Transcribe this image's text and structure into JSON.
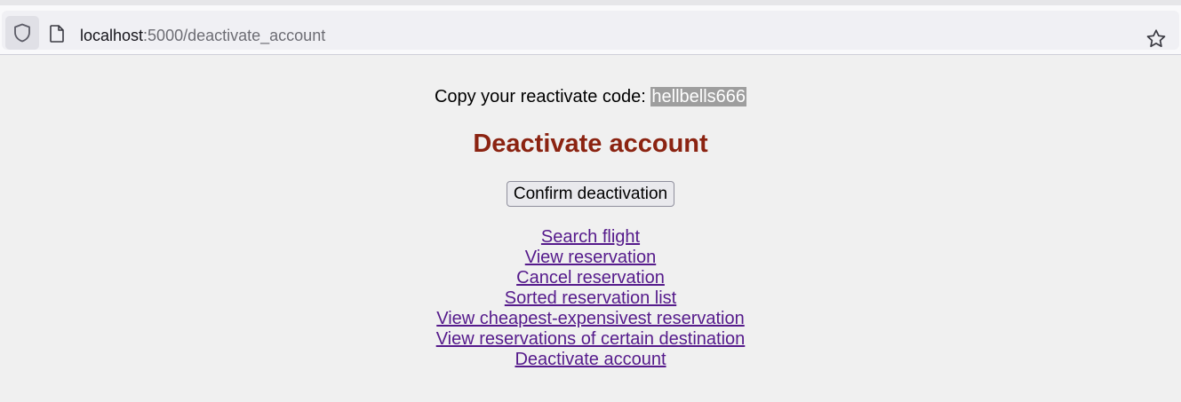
{
  "browser": {
    "url_host": "localhost",
    "url_path": ":5000/deactivate_account"
  },
  "icons": {
    "shield": "shield-icon",
    "page": "page-icon",
    "bookmark": "star-icon"
  },
  "page": {
    "code_prompt": "Copy your reactivate code: ",
    "code_value": "hellbells666",
    "heading": "Deactivate account",
    "confirm_button": "Confirm deactivation",
    "links": [
      "Search flight",
      "View reservation",
      "Cancel reservation",
      "Sorted reservation list",
      "View cheapest-expensivest reservation",
      "View reservations of certain destination",
      "Deactivate account"
    ]
  },
  "colors": {
    "heading": "#8b2311",
    "link_visited": "#551a8b",
    "highlight": "#9e9e9e"
  }
}
